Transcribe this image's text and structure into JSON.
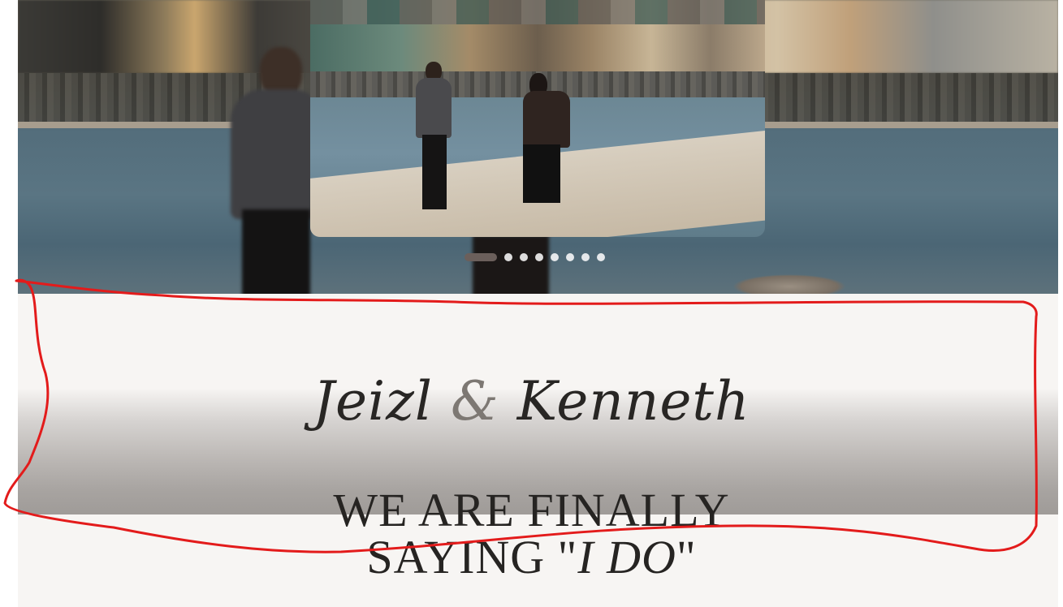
{
  "hero": {
    "carousel": {
      "slide_count": 8,
      "active_index": 0
    }
  },
  "title": {
    "first_name": "Jeizl",
    "ampersand": "&",
    "second_name": "Kenneth"
  },
  "tagline": {
    "line1": "WE ARE FINALLY",
    "line2_prefix": "SAYING \"",
    "line2_emphasis": "I DO",
    "line2_suffix": "\""
  },
  "annotation": {
    "color": "#e31b1b"
  }
}
